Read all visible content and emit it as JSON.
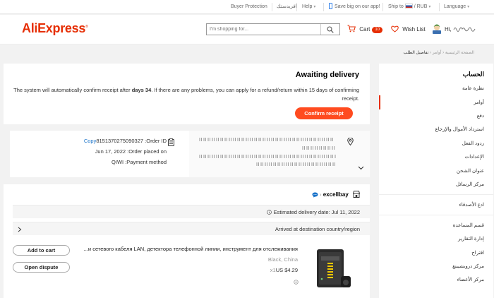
{
  "topbar": {
    "buyer_protection": "Buyer Protection",
    "arabic_link": "افريدستك",
    "help": "Help",
    "app_promo": "Save big on our app!",
    "ship_to": "Ship to",
    "currency": "RUB",
    "language": "Language"
  },
  "header": {
    "logo": "AliExpress",
    "search_placeholder": "I'm shopping for...",
    "cart_label": "Cart",
    "cart_count": "10",
    "wishlist_label": "Wish List",
    "greeting": "Hi, "
  },
  "breadcrumb": {
    "home": "الصفحة الرئيسية",
    "orders": "أوامر",
    "current": "تفاصيل الطلب"
  },
  "sidebar": {
    "title": "الحساب",
    "items": [
      "نظرة عامة",
      "أوامر",
      "دفع",
      "استرداد الأموال والإرجاع",
      "ردود الفعل",
      "الإعدادات",
      "عنوان الشحن",
      "مركز الرسائل",
      "ادع الأصدقاء",
      "قسم المساعدة",
      "إدارة التقارير",
      "اقتراح",
      "مركز دروبشيبنغ",
      "مركز الأعضاء"
    ]
  },
  "awaiting": {
    "title": "Awaiting delivery",
    "text_before": "The system will automatically confirm receipt after ",
    "days": "days 34",
    "text_after": ". If there are any problems, you can apply for a refund/return within 15 days of confirming receipt.",
    "confirm_button": "Confirm receipt"
  },
  "order_info": {
    "copy": "Copy",
    "order_id": "8151370275090327 :Order ID",
    "placed_on": "Jun 17, 2022 :Order placed on",
    "payment": "QIWI :Payment method"
  },
  "store": {
    "name": "excellbay",
    "estimated_delivery": "Estimated delivery date: Jul 11, 2022",
    "status": "Arrived at destination country/region",
    "add_to_cart": "Add to cart",
    "open_dispute": "Open dispute",
    "product_title": "...и сетевого кабеля LAN, детектора телефонной линии, инструмент для отслеживания",
    "product_variant": "Black, China",
    "product_price": "US $4.29",
    "product_qty": "x1"
  },
  "colors": {
    "brand": "#e62e04",
    "button": "#ff4b1f",
    "link": "#1a73c9"
  }
}
